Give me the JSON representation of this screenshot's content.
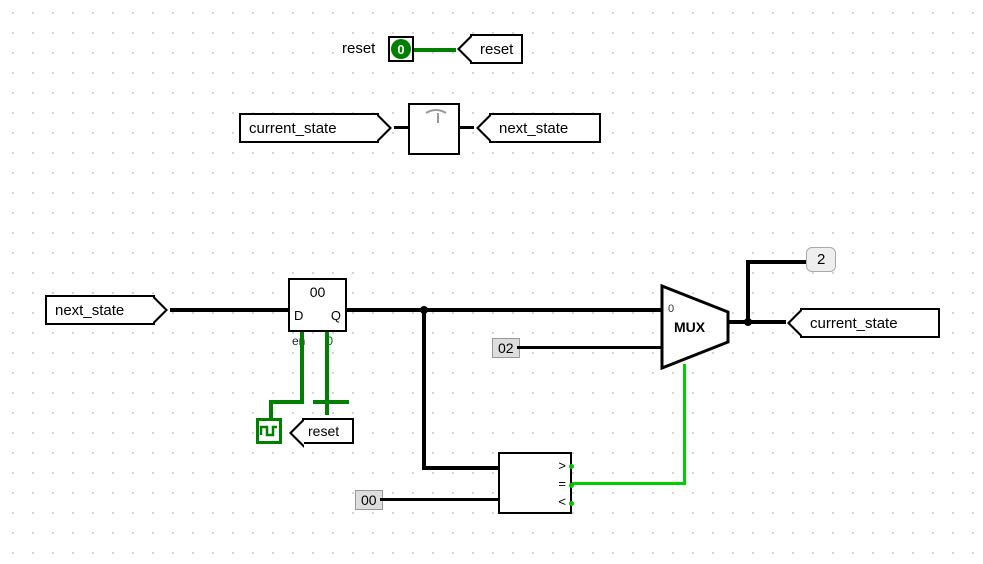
{
  "blocks": {
    "reset_label": "reset",
    "reset_tag": "reset",
    "led_value": "0",
    "current_state_tag_top": "current_state",
    "next_state_tag_top": "next_state",
    "next_state_tag_left": "next_state",
    "current_state_tag_right": "current_state",
    "reset_tag_bottom": "reset",
    "register": {
      "value": "00",
      "d": "D",
      "q": "Q",
      "en": "en",
      "clk": "0"
    },
    "mux": {
      "label": "MUX",
      "sel": "0"
    },
    "const_two": "2",
    "const_02": "02",
    "const_00": "00",
    "compare": {
      "gt": ">",
      "eq": "=",
      "lt": "<"
    }
  }
}
